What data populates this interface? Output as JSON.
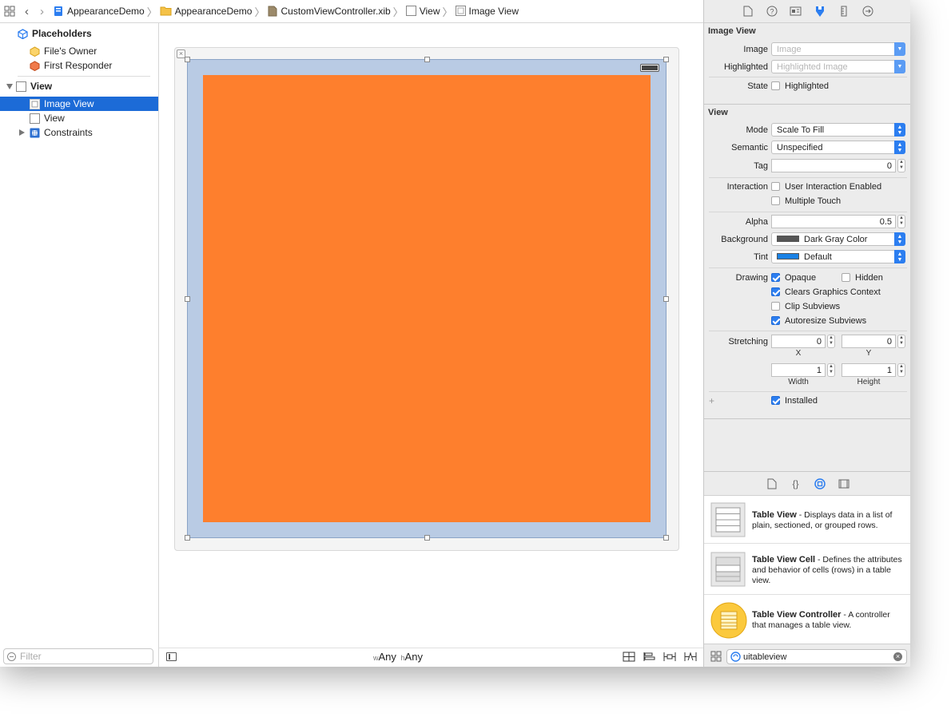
{
  "jumpbar": {
    "items": [
      "AppearanceDemo",
      "AppearanceDemo",
      "CustomViewController.xib",
      "View",
      "Image View"
    ]
  },
  "outline": {
    "placeholders": "Placeholders",
    "files_owner": "File's Owner",
    "first_responder": "First Responder",
    "view": "View",
    "image_view": "Image View",
    "subview": "View",
    "constraints": "Constraints",
    "filter_placeholder": "Filter"
  },
  "canvas": {
    "image_color": "#fe7f2d",
    "size_w_prefix": "w",
    "size_w": "Any",
    "size_h_prefix": "h",
    "size_h": "Any"
  },
  "inspector": {
    "image_view_section": "Image View",
    "image_label": "Image",
    "image_placeholder": "Image",
    "highlighted_label": "Highlighted",
    "highlighted_placeholder": "Highlighted Image",
    "state_label": "State",
    "state_highlighted": "Highlighted",
    "view_section": "View",
    "mode_label": "Mode",
    "mode_value": "Scale To Fill",
    "semantic_label": "Semantic",
    "semantic_value": "Unspecified",
    "tag_label": "Tag",
    "tag_value": "0",
    "interaction_label": "Interaction",
    "user_interaction": "User Interaction Enabled",
    "multiple_touch": "Multiple Touch",
    "alpha_label": "Alpha",
    "alpha_value": "0.5",
    "background_label": "Background",
    "background_value": "Dark Gray Color",
    "background_color": "#555555",
    "tint_label": "Tint",
    "tint_value": "Default",
    "tint_color": "#1a82e6",
    "drawing_label": "Drawing",
    "opaque": "Opaque",
    "hidden": "Hidden",
    "clears_graphics": "Clears Graphics Context",
    "clip_subviews": "Clip Subviews",
    "autoresize_subviews": "Autoresize Subviews",
    "stretching_label": "Stretching",
    "stretch_x": "0",
    "stretch_y": "0",
    "x_label": "X",
    "y_label": "Y",
    "stretch_w": "1",
    "stretch_h": "1",
    "width_label": "Width",
    "height_label": "Height",
    "installed": "Installed",
    "plus": "+"
  },
  "library": {
    "items": [
      {
        "title": "Table View",
        "desc": " - Displays data in a list of plain, sectioned, or grouped rows."
      },
      {
        "title": "Table View Cell",
        "desc": " - Defines the attributes and behavior of cells (rows) in a table view."
      },
      {
        "title": "Table View Controller",
        "desc": " - A controller that manages a table view."
      }
    ],
    "search_value": "uitableview"
  }
}
